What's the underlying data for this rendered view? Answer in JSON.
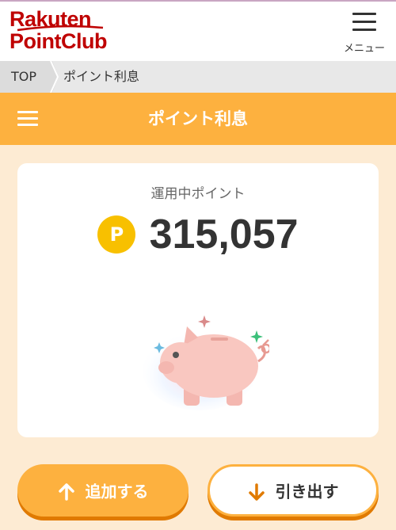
{
  "header": {
    "logo_line1": "Rakuten",
    "logo_line2": "PointClub",
    "menu_label": "メニュー"
  },
  "breadcrumb": {
    "top": "TOP",
    "current": "ポイント利息"
  },
  "title_bar": {
    "title": "ポイント利息"
  },
  "card": {
    "label": "運用中ポイント",
    "point_icon": "P",
    "points": "315,057"
  },
  "actions": {
    "add_label": "追加する",
    "withdraw_label": "引き出す"
  },
  "colors": {
    "brand_red": "#bf0000",
    "accent_orange": "#fdb13f",
    "page_background": "#fdebd3",
    "point_icon": "#f8c000"
  },
  "icons": {
    "menu": "hamburger-icon",
    "point": "point-coin-icon",
    "pig": "piggy-bank-icon",
    "add": "arrow-up-icon",
    "withdraw": "arrow-down-icon"
  }
}
